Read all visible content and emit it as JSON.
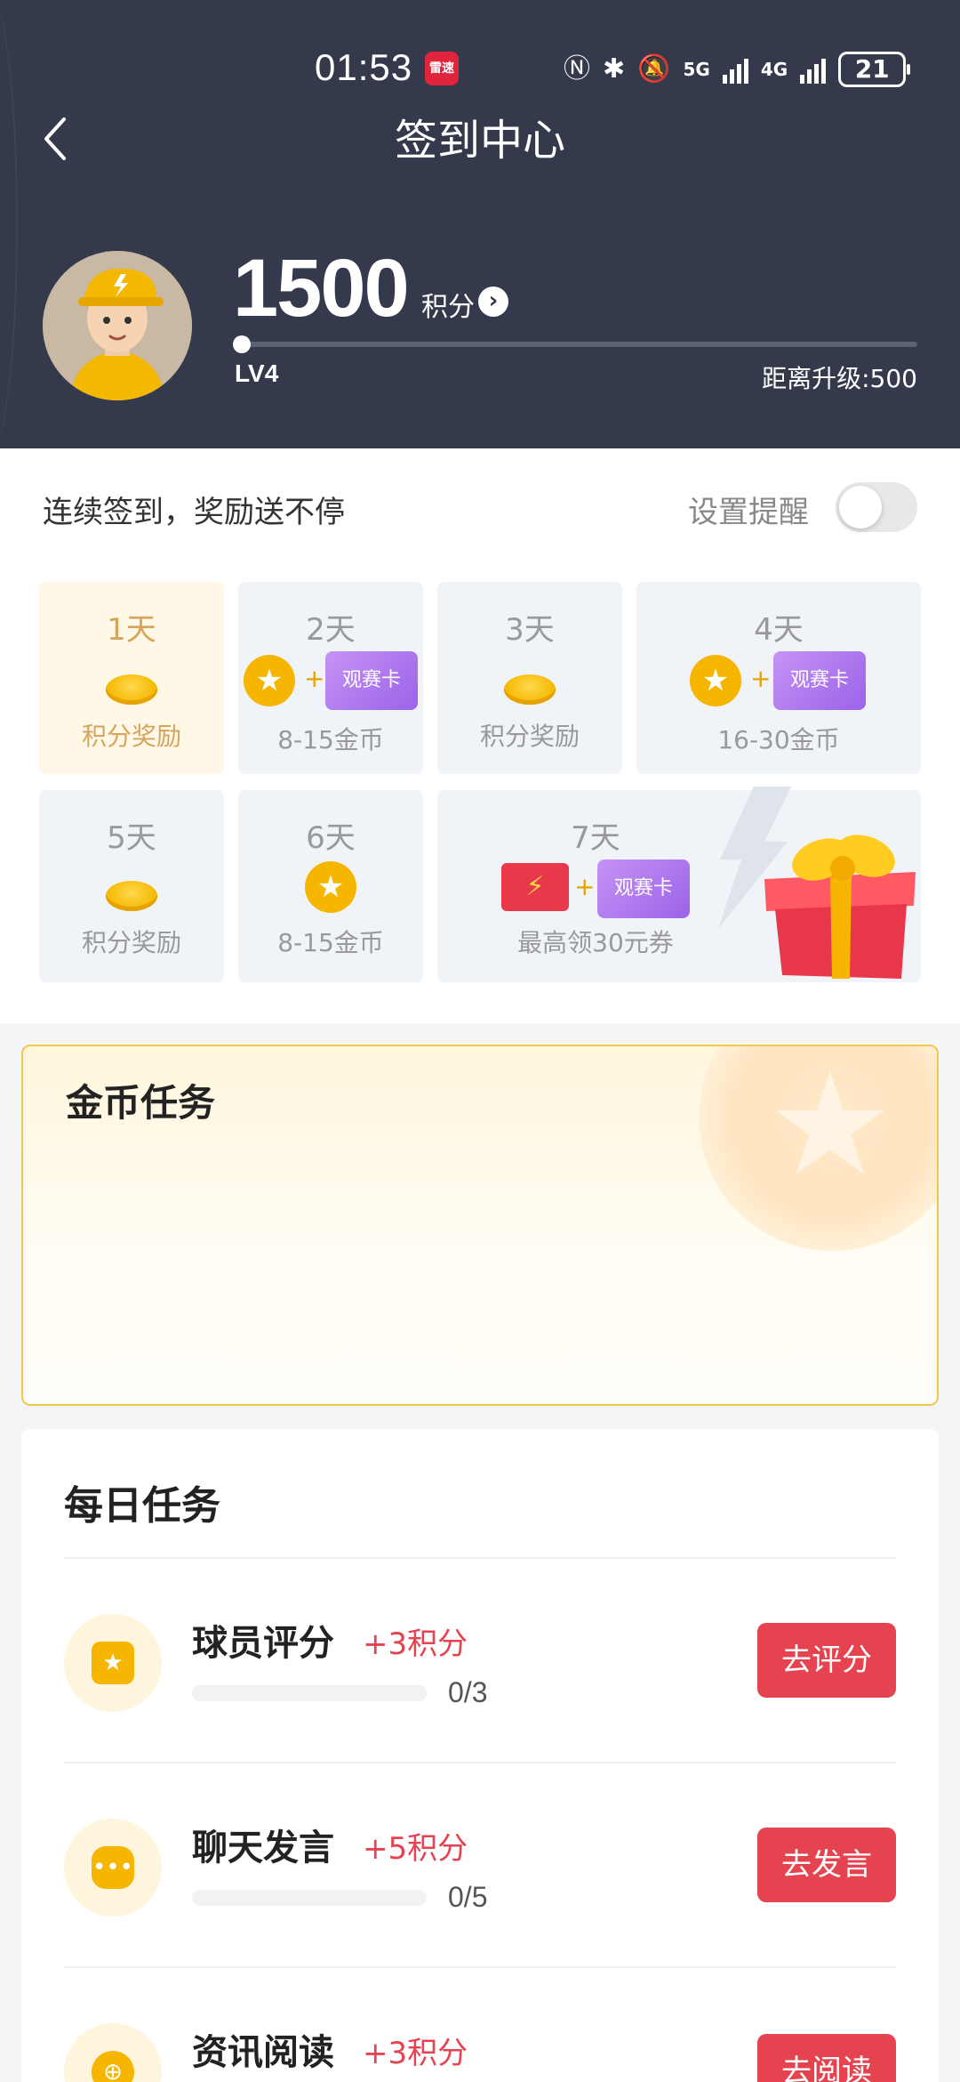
{
  "status_bar": {
    "time": "01:53",
    "app_icon_text": "雷速",
    "network_1": "5G",
    "network_2": "4G",
    "battery": "21",
    "icons": [
      "nfc-icon",
      "bluetooth-icon",
      "vibrate-icon",
      "mute-icon"
    ]
  },
  "header": {
    "title": "签到中心",
    "points": "1500",
    "points_unit": "积分",
    "level": "LV4",
    "level_remaining": "距离升级:500",
    "level_progress": 0
  },
  "signin": {
    "title": "连续签到，奖励送不停",
    "reminder_label": "设置提醒",
    "reminder_on": false,
    "days": [
      {
        "label": "1天",
        "reward": "积分奖励"
      },
      {
        "label": "2天",
        "reward": "8-15金币",
        "card": "观赛卡"
      },
      {
        "label": "3天",
        "reward": "积分奖励"
      },
      {
        "label": "4天",
        "reward": "16-30金币",
        "card": "观赛卡"
      },
      {
        "label": "5天",
        "reward": "积分奖励"
      },
      {
        "label": "6天",
        "reward": "8-15金币"
      },
      {
        "label": "7天",
        "reward": "最高领30元券",
        "card": "观赛卡"
      }
    ],
    "plus": "+"
  },
  "coin_tasks": {
    "title": "金币任务"
  },
  "daily_tasks": {
    "title": "每日任务",
    "items": [
      {
        "name": "球员评分",
        "points": "+3积分",
        "progress": "0/3",
        "button": "去评分",
        "icon": "clipboard-star-icon"
      },
      {
        "name": "聊天发言",
        "points": "+5积分",
        "progress": "0/5",
        "button": "去发言",
        "icon": "chat-bubble-icon"
      },
      {
        "name": "资讯阅读",
        "points": "+3积分",
        "progress": "",
        "button": "去阅读",
        "icon": "globe-icon"
      }
    ]
  },
  "colors": {
    "header_bg": "#343a4b",
    "accent_red": "#e5434f",
    "gold": "#f6b600",
    "card_purple": "#9b63e8"
  }
}
